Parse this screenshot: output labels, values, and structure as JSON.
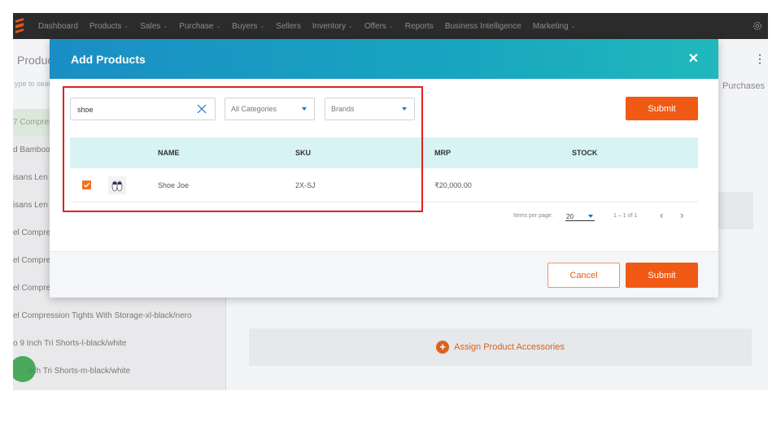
{
  "topnav": {
    "items": [
      {
        "label": "Dashboard",
        "dropdown": false
      },
      {
        "label": "Products",
        "dropdown": true
      },
      {
        "label": "Sales",
        "dropdown": true
      },
      {
        "label": "Purchase",
        "dropdown": true
      },
      {
        "label": "Buyers",
        "dropdown": true
      },
      {
        "label": "Sellers",
        "dropdown": false
      },
      {
        "label": "Inventory",
        "dropdown": true
      },
      {
        "label": "Offers",
        "dropdown": true
      },
      {
        "label": "Reports",
        "dropdown": false
      },
      {
        "label": "Business Intelligence",
        "dropdown": false
      },
      {
        "label": "Marketing",
        "dropdown": true
      }
    ],
    "dropdown_glyph": "⌄",
    "settings_icon": "gear-icon"
  },
  "background": {
    "title": "Produc",
    "search_placeholder": "ype to sear",
    "purchases_tab": "Purchases",
    "sidebar_items": [
      "7 Compres",
      "d Bamboo",
      "isans Len",
      "isans Len",
      "el Compre",
      "el Compre",
      "el Compre",
      "el Compression Tights With Storage-xl-black/nero",
      "o 9 Inch Tri Shorts-l-black/white",
      "nch Tri Shorts-m-black/white"
    ],
    "assign_label": "Assign Product Accessories"
  },
  "modal": {
    "title": "Add Products",
    "close_glyph": "✕",
    "search": {
      "value": "shoe",
      "placeholder": ""
    },
    "category_select": "All Categories",
    "brand_select": "Brands",
    "submit_top": "Submit",
    "columns": [
      "NAME",
      "SKU",
      "MRP",
      "STOCK"
    ],
    "rows": [
      {
        "checked": true,
        "name": "Shoe Joe",
        "sku": "2X-SJ",
        "mrp": "₹20,000.00",
        "stock": ""
      }
    ],
    "pagination": {
      "items_per_page_label": "Items per page:",
      "items_per_page": "20",
      "range": "1 – 1 of 1",
      "prev": "‹",
      "next": "›"
    },
    "cancel": "Cancel",
    "submit": "Submit"
  },
  "colors": {
    "accent_orange": "#f05a14",
    "header_gradient_start": "#1a8ec5",
    "header_gradient_end": "#20b8bc",
    "table_header_bg": "#d8f3f4",
    "highlight_red": "#e02020"
  }
}
